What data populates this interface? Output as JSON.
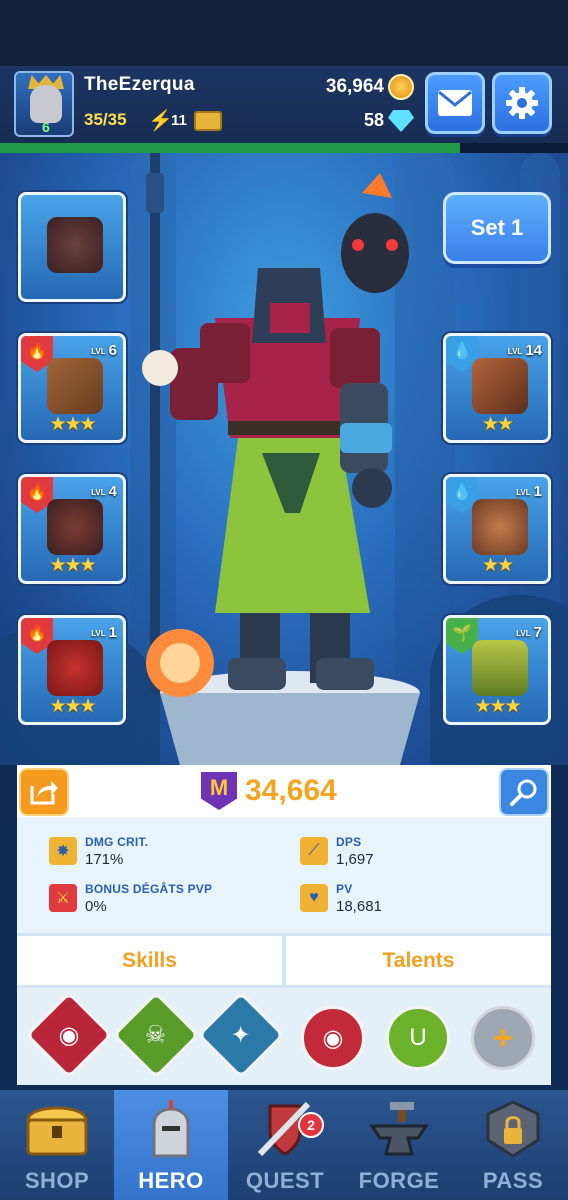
{
  "player": {
    "name": "TheEzerqua",
    "level": "6",
    "energy": "35/35",
    "keys": "11"
  },
  "currency": {
    "gold": "36,964",
    "gems": "58"
  },
  "xp_progress": 0.81,
  "set_button": "Set 1",
  "slots_left": [
    {
      "name": "pet",
      "element": null,
      "level": null,
      "stars": 0
    },
    {
      "name": "weapon-hammer",
      "element": "fire",
      "level": "6",
      "stars": 3
    },
    {
      "name": "helmet",
      "element": "fire",
      "level": "4",
      "stars": 3
    },
    {
      "name": "armor",
      "element": "fire",
      "level": "1",
      "stars": 3
    }
  ],
  "slots_right": [
    {
      "name": "shield",
      "element": "water",
      "level": "14",
      "stars": 2
    },
    {
      "name": "gloves",
      "element": "water",
      "level": "1",
      "stars": 2
    },
    {
      "name": "boots",
      "element": "nature",
      "level": "7",
      "stars": 3
    }
  ],
  "slot_level_prefix": "LVL",
  "power": "34,664",
  "power_badge": "M",
  "stats": {
    "crit": {
      "label": "DMG CRIT.",
      "value": "171%"
    },
    "dps": {
      "label": "DPS",
      "value": "1,697"
    },
    "pvp": {
      "label": "BONUS DÉGÂTS PVP",
      "value": "0%"
    },
    "pv": {
      "label": "PV",
      "value": "18,681"
    }
  },
  "tabs": {
    "skills": "Skills",
    "talents": "Talents"
  },
  "talent_add": "+",
  "nav": {
    "shop": "SHOP",
    "hero": "HERO",
    "quest": "QUEST",
    "forge": "FORGE",
    "pass": "PASS",
    "quest_badge": "2"
  },
  "colors": {
    "fire": "#e0393e",
    "water": "#3aa0e6",
    "nature": "#46b04a",
    "power": "#f4a41f",
    "stat_label": "#2b5fae"
  }
}
